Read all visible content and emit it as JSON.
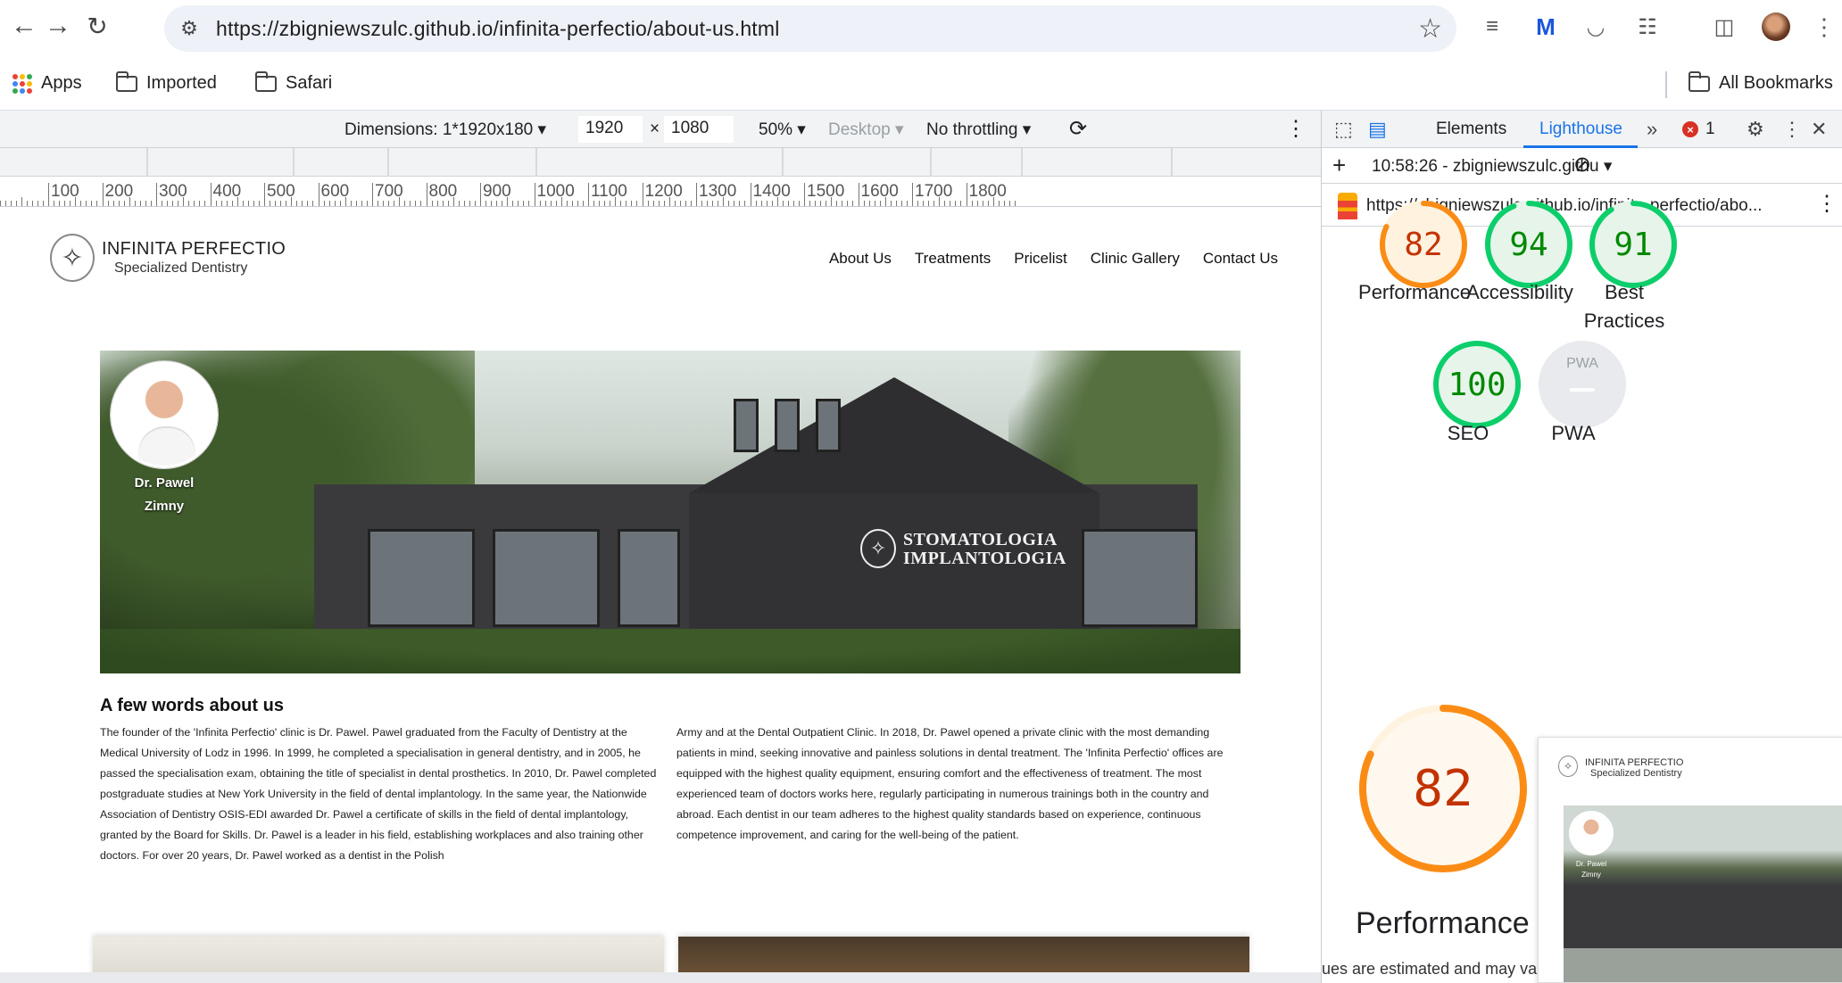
{
  "browser": {
    "url": "https://zbigniewszulc.github.io/infinita-perfectio/about-us.html",
    "bookmarks": [
      "Apps",
      "Imported",
      "Safari"
    ],
    "all_bookmarks": "All Bookmarks",
    "icons": [
      "back-arrow-icon",
      "forward-arrow-icon",
      "reload-icon",
      "site-settings-icon",
      "bookmark-star-icon",
      "tab-search-icon",
      "extension-m-icon",
      "extension-arc-icon",
      "puzzle-extensions-icon",
      "side-panel-icon",
      "profile-avatar",
      "kebab-menu-icon"
    ]
  },
  "device_toolbar": {
    "dimensions": "Dimensions: 1*1920x180",
    "width": "1920",
    "times": "×",
    "height": "1080",
    "zoom": "50%",
    "device_type": "Desktop",
    "throttling": "No throttling",
    "ruler_labels": [
      "100",
      "200",
      "300",
      "400",
      "500",
      "600",
      "700",
      "800",
      "900",
      "1000",
      "1100",
      "1200",
      "1300",
      "1400",
      "1500",
      "1600",
      "1700",
      "1800"
    ]
  },
  "site": {
    "brand": "INFINITA PERFECTIO",
    "tagline": "Specialized Dentistry",
    "nav": [
      "About Us",
      "Treatments",
      "Pricelist",
      "Clinic Gallery",
      "Contact Us"
    ],
    "doctor_name_line1": "Dr. Pawel",
    "doctor_name_line2": "Zimny",
    "sign_line1": "STOMATOLOGIA",
    "sign_line2": "IMPLANTOLOGIA",
    "about_title": "A few words about us",
    "about_col1": "The founder of the 'Infinita Perfectio' clinic is Dr. Pawel. Pawel graduated from the Faculty of Dentistry at the Medical University of Lodz in 1996. In 1999, he completed a specialisation in general dentistry, and in 2005, he passed the specialisation exam, obtaining the title of specialist in dental prosthetics. In 2010, Dr. Pawel completed postgraduate studies at New York University in the field of dental implantology. In the same year, the Nationwide Association of Dentistry OSIS-EDI awarded Dr. Pawel a certificate of skills in the field of dental implantology, granted by the Board for Skills. Dr. Pawel is a leader in his field, establishing workplaces and also training other doctors. For over 20 years, Dr. Pawel worked as a dentist in the Polish",
    "about_col2": "Army and at the Dental Outpatient Clinic. In 2018, Dr. Pawel opened a private clinic with the most demanding patients in mind, seeking innovative and painless solutions in dental treatment. The 'Infinita Perfectio' offices are equipped with the highest quality equipment, ensuring comfort and the effectiveness of treatment. The most experienced team of doctors works here, regularly participating in numerous trainings both in the country and abroad. Each dentist in our team adheres to the highest quality standards based on experience, continuous competence improvement, and caring for the well-being of the patient."
  },
  "devtools": {
    "tabs": [
      "Elements",
      "Lighthouse"
    ],
    "active_tab": "Lighthouse",
    "error_count": "1",
    "report_label": "10:58:26 - zbigniewszulc.githu",
    "report_url": "https://zbigniewszulc.github.io/infinita-perfectio/abo...",
    "scores": [
      {
        "label": "Performance",
        "value": "82",
        "fraction": 0.82,
        "color": "#fa8c16",
        "text_color": "#c33300",
        "fill": "#fff3e0"
      },
      {
        "label": "Accessibility",
        "value": "94",
        "fraction": 0.94,
        "color": "#0cce6b",
        "text_color": "#008800",
        "fill": "#e6f4ea"
      },
      {
        "label": "Best Practices",
        "value": "91",
        "fraction": 0.91,
        "color": "#0cce6b",
        "text_color": "#008800",
        "fill": "#e6f4ea"
      },
      {
        "label": "SEO",
        "value": "100",
        "fraction": 1.0,
        "color": "#0cce6b",
        "text_color": "#008800",
        "fill": "#e6f4ea"
      },
      {
        "label": "PWA",
        "value": "PWA",
        "fraction": 0,
        "color": "#d0d0d0",
        "text_color": "#9aa0a6",
        "fill": "#e8eaed"
      }
    ],
    "big_score": {
      "label": "Performance",
      "value": "82",
      "fraction": 0.82
    },
    "thumb_brand": "INFINITA PERFECTIO",
    "thumb_tagline": "Specialized Dentistry",
    "thumb_doctor": "Dr. Pawel Zimny",
    "note": "ues are estimated and may va"
  }
}
